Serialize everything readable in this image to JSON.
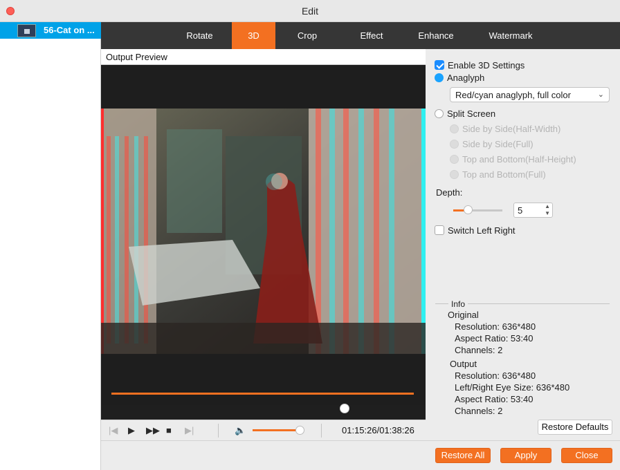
{
  "window": {
    "title": "Edit"
  },
  "file_list": {
    "items": [
      {
        "label": "56-Cat on ..."
      }
    ]
  },
  "tabs": [
    {
      "label": "Rotate",
      "active": false
    },
    {
      "label": "3D",
      "active": true
    },
    {
      "label": "Crop",
      "active": false
    },
    {
      "label": "Effect",
      "active": false
    },
    {
      "label": "Enhance",
      "active": false
    },
    {
      "label": "Watermark",
      "active": false
    }
  ],
  "preview": {
    "label": "Output Preview",
    "timecode": "01:15:26/01:38:26",
    "seek_progress": 0.78,
    "volume_level": 0.9
  },
  "settings": {
    "enable_3d": {
      "label": "Enable 3D Settings",
      "checked": true
    },
    "anaglyph": {
      "label": "Anaglyph",
      "selected": true
    },
    "anaglyph_mode": {
      "value": "Red/cyan anaglyph, full color"
    },
    "split_screen": {
      "label": "Split Screen",
      "selected": false
    },
    "split_options": [
      "Side by Side(Half-Width)",
      "Side by Side(Full)",
      "Top and Bottom(Half-Height)",
      "Top and Bottom(Full)"
    ],
    "depth": {
      "label": "Depth:",
      "value": "5",
      "level": 0.3
    },
    "switch_left_right": {
      "label": "Switch Left Right",
      "checked": false
    }
  },
  "info": {
    "title": "Info",
    "original": {
      "heading": "Original",
      "resolution": "Resolution: 636*480",
      "aspect": "Aspect Ratio: 53:40",
      "channels": "Channels: 2"
    },
    "output": {
      "heading": "Output",
      "resolution": "Resolution: 636*480",
      "eye_size": "Left/Right Eye Size: 636*480",
      "aspect": "Aspect Ratio: 53:40",
      "channels": "Channels: 2"
    }
  },
  "buttons": {
    "restore_defaults": "Restore Defaults",
    "restore_all": "Restore All",
    "apply": "Apply",
    "close": "Close"
  },
  "colors": {
    "accent": "#f37021",
    "selection": "#00a2e8",
    "check": "#1a8cff"
  }
}
